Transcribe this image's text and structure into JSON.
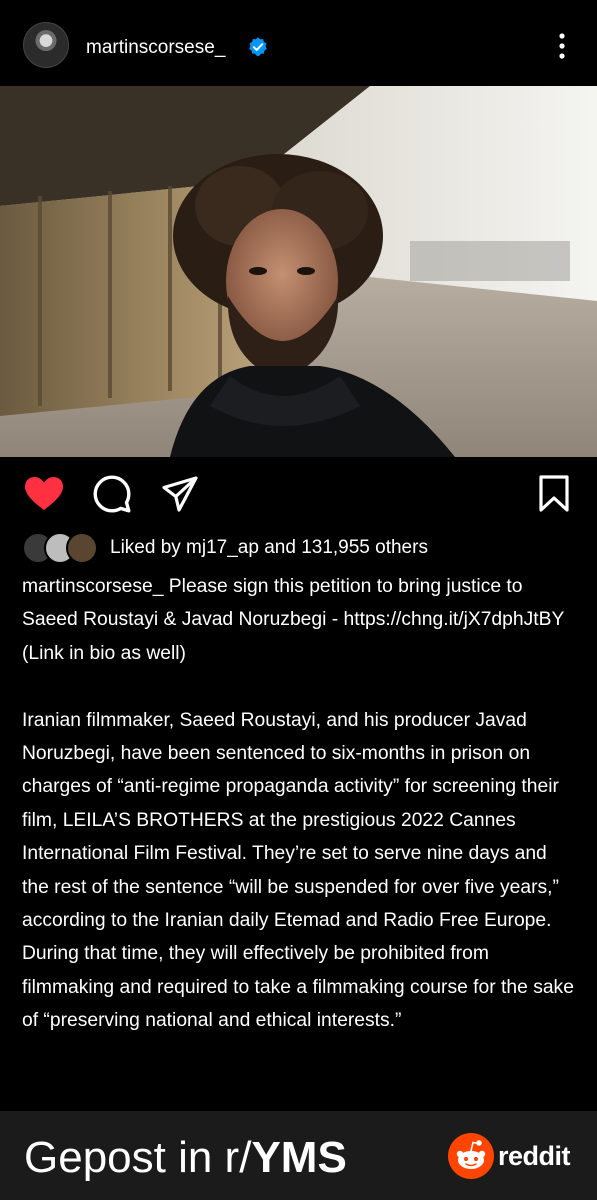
{
  "post": {
    "username": "martinscorsese_",
    "verified": true,
    "photo_icon": "portrait-photo"
  },
  "likes": {
    "text": "Liked by mj17_ap and 131,955 others",
    "liked": true
  },
  "caption": {
    "lines": [
      "martinscorsese_ Please sign this petition to bring justice to Saeed Roustayi & Javad Noruzbegi - https://chng.it/jX7dphJtBY",
      "(Link in bio as well)",
      "",
      "Iranian filmmaker, Saeed Roustayi, and his producer Javad Noruzbegi, have been sentenced to six-months in prison on charges of “anti-regime propaganda activity” for screening their film, LEILA’S BROTHERS at the prestigious 2022 Cannes International Film Festival. They’re set to serve nine days and the rest of the sentence “will be suspended for over five years,” according to the Iranian daily Etemad and Radio Free Europe. During that time, they will effectively be prohibited from filmmaking and required to take a filmmaking course for the sake of “preserving national and ethical interests.”"
    ]
  },
  "footer": {
    "prefix": "Gepost in r/",
    "subreddit": "YMS",
    "brand": "reddit"
  },
  "colors": {
    "background": "#000000",
    "heart": "#ff3040",
    "verified": "#0095f6",
    "footer_bg": "#1b1b1b",
    "reddit_orange": "#ff4500"
  },
  "icons": [
    "verified-badge-icon",
    "more-options-icon",
    "heart-icon",
    "comment-icon",
    "share-icon",
    "bookmark-icon",
    "reddit-icon"
  ]
}
